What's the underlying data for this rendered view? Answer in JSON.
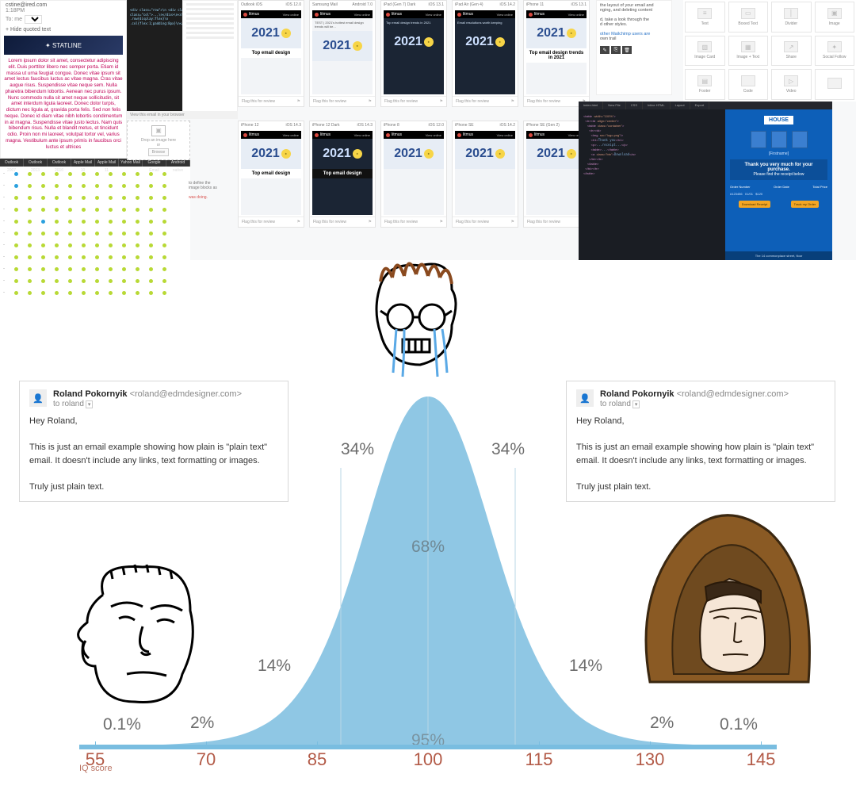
{
  "gmail": {
    "from_addr": "cstine@ired.com",
    "time": "1:18PM",
    "to_label": "To: me",
    "hide_quoted": "+ Hide quoted text",
    "brand": "✦ STATLINE",
    "lorem": "Lorem ipsum dolor sit amet, consectetur adipiscing elit. Duis porttitor libero nec semper porta. Etiam id massa ut urna feugiat congue. Donec vitae ipsum sit amet lectus faucibus luctus ac vitae magna. Cras vitae augue risus. Suspendisse vitae neque sem. Nulla pharetra bibendum lobortis. Aenean nec purus ipsum. Nunc commodo nulla sit amet neque sollicitudin, sit amet interdum ligula laoreet. Donec dolor turpis, dictum nec ligula at, gravida porta felis. Sed non felis neque. Donec id diam vitae nibh lobortis condimentum in at magna. Suspendisse vitae justo lectus. Nam quis bibendum risus. Nulla et blandit metus, et tincidunt odio. Proin non mi laoreet, volutpat tortor vel, varius magna. Vestibulum ante ipsum primis in faucibus orci luctus et ultrices"
  },
  "dotgrid": {
    "tabs": [
      "Outlook 2007",
      "Outlook 2013",
      "Outlook 2016",
      "Apple Mail 10",
      "Apple Mail 11",
      "Yahoo Mail",
      "Google Email",
      "Android native"
    ]
  },
  "codebox": {
    "text": "<div class=\"row\">\\n  <div class=\"col\">...\\n  <div class=\"col\">...\\n</div>\\n<style>\\n .row{display:flex}\\n .col{flex:1;padding:8px}\\n</style>"
  },
  "view_browser": "View this email in your browser",
  "builder": {
    "drop": "Drop an image here",
    "or": "or",
    "browse": "Browse"
  },
  "define_text": {
    "a": "to define the",
    "b": "image blocks as",
    "c": "was doing."
  },
  "litmus": {
    "row1": [
      {
        "device": "Outlook iOS",
        "ver": "iOS 12.0",
        "dark": false,
        "year": "2021",
        "cap": "Top email design",
        "subject": ""
      },
      {
        "device": "Samsung Mail",
        "ver": "Android 7.0",
        "dark": false,
        "year": "2021",
        "cap": "",
        "subject": "TEST | 2021's hottest email design trends will be..."
      },
      {
        "device": "iPad (Gen 7) Dark",
        "ver": "iOS 13.1",
        "dark": true,
        "year": "2021",
        "cap": "",
        "subject": "Top email design trends in 2021"
      },
      {
        "device": "iPad Air (Gen 4)",
        "ver": "iOS 14.2",
        "dark": true,
        "year": "2021",
        "cap": "",
        "subject": "Email resolutions worth keeping"
      },
      {
        "device": "iPhone 11",
        "ver": "iOS 13.1",
        "dark": false,
        "year": "2021",
        "cap": "Top email design trends in 2021",
        "subject": ""
      }
    ],
    "row2": [
      {
        "device": "iPhone 12",
        "ver": "iOS 14.3",
        "dark": false,
        "year": "2021",
        "cap": "Top email design"
      },
      {
        "device": "iPhone 12 Dark",
        "ver": "iOS 14.3",
        "dark": true,
        "year": "2021",
        "cap": "Top email design"
      },
      {
        "device": "iPhone 8",
        "ver": "iOS 12.0",
        "dark": false,
        "year": "2021",
        "cap": ""
      },
      {
        "device": "iPhone SE",
        "ver": "iOS 14.2",
        "dark": false,
        "year": "2021",
        "cap": ""
      },
      {
        "device": "iPhone SE (Gen 2)",
        "ver": "",
        "dark": false,
        "year": "2021",
        "cap": ""
      }
    ],
    "brand": "litmus",
    "view": "View online",
    "flag": "Flag this for review"
  },
  "mc": {
    "l1": "the layout of your email and",
    "l2": "nging, and deleting content",
    "l3": "d, take a look through the",
    "l4": "d other styles.",
    "link": "other Mailchimp users are",
    "l5": "own trail"
  },
  "blocks": {
    "items": [
      "Text",
      "Boxed Text",
      "Divider",
      "Image",
      "Image Card",
      "Image + Text",
      "Share",
      "Social Follow",
      "Footer",
      "Code",
      "Video",
      ""
    ]
  },
  "dark_tabs": [
    "index.html",
    "New File",
    "CSS",
    "Inline HTML",
    "Layout",
    "Export"
  ],
  "house": {
    "logo": "HOUSE",
    "thank_b": "Thank you very much for your purchase.",
    "thank_s": "Please find the receipt below",
    "col1": "Order Number",
    "col2": "Order Date",
    "col3": "Total Price",
    "btn1": "Download Receipt",
    "btn2": "Track my Order",
    "foot": "The 14 commonplace street, floor"
  },
  "mail_left": {
    "name": "Roland Pokornyik",
    "email": "<roland@edmdesigner.com>",
    "to": "to roland",
    "greet": "Hey Roland,",
    "p1": "This is just an email example showing how plain is \"plain text\" email. It doesn't include any links, text formatting or images.",
    "p2": "Truly just plain text."
  },
  "mail_right": {
    "name": "Roland Pokornyik",
    "email": "<roland@edmdesigner.com>",
    "to": "to roland",
    "greet": "Hey Roland,",
    "p1": "This is just an email example showing how plain is \"plain text\" email. It doesn't include any links, text formatting or images.",
    "p2": "Truly just plain text."
  },
  "chart_data": {
    "type": "area",
    "title": "",
    "xlabel": "IQ score",
    "ylabel": "",
    "x": [
      55,
      70,
      85,
      100,
      115,
      130,
      145
    ],
    "labels_top": [
      "34%",
      "34%"
    ],
    "labels_mid": "68%",
    "labels_low": "95%",
    "side_pct_inner": [
      "14%",
      "14%"
    ],
    "side_pct_mid": [
      "2%",
      "2%"
    ],
    "side_pct_outer": [
      "0.1%",
      "0.1%"
    ]
  }
}
